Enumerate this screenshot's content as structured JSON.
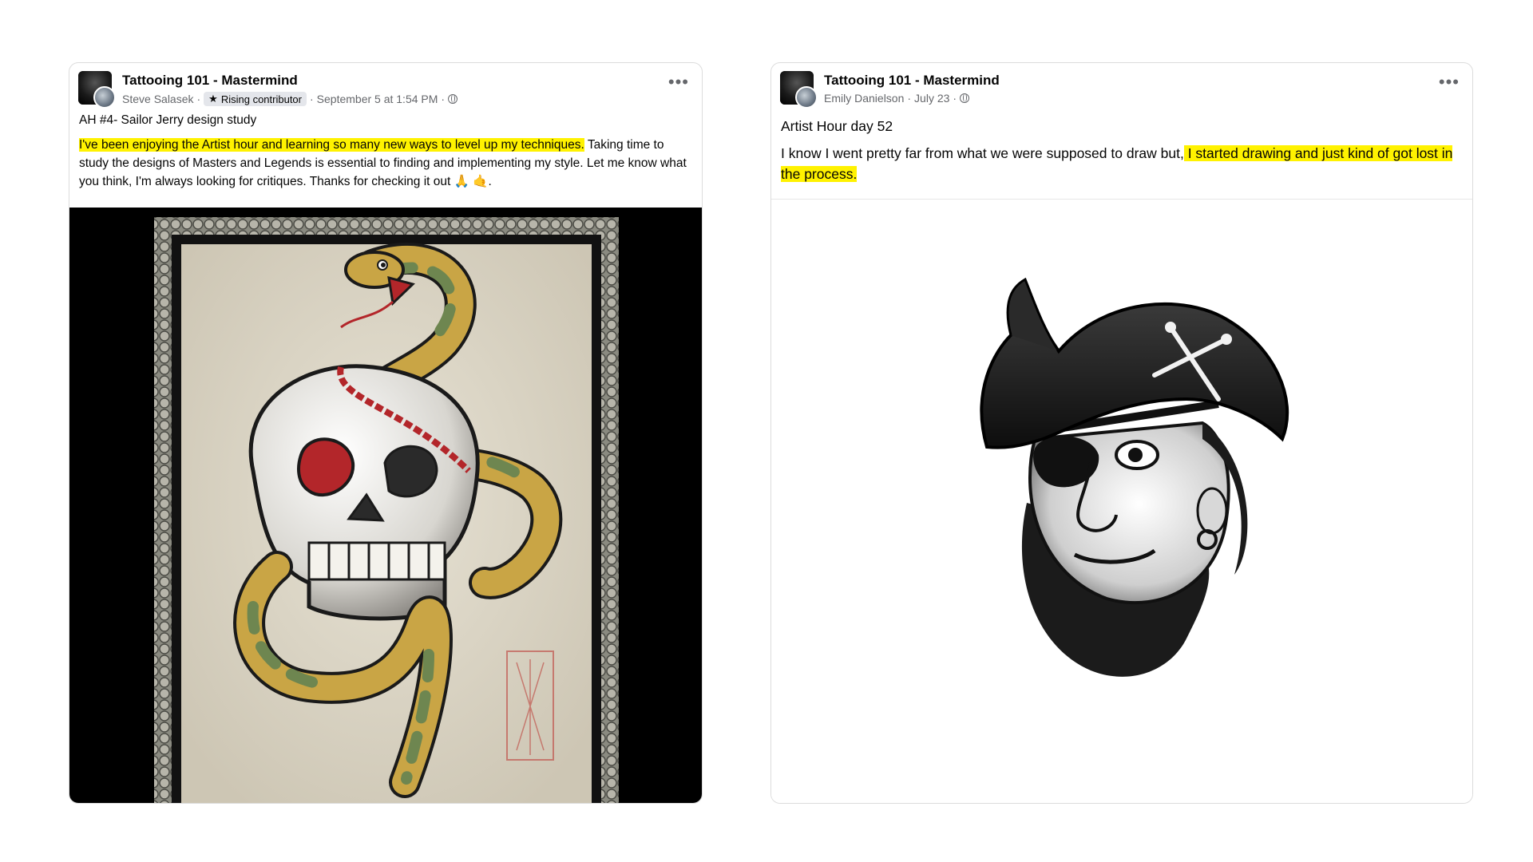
{
  "posts": [
    {
      "group": "Tattooing 101 - Mastermind",
      "author": "Steve Salasek",
      "badge": "Rising contributor",
      "time": "September 5 at 1:54 PM",
      "heading": "AH #4- Sailor Jerry design study",
      "highlight": "I've been enjoying the Artist hour and learning so many new ways to level up my techniques.",
      "rest": " Taking time to study the designs of Masters and Legends is essential to finding and implementing my style. Let me know what you think, I'm always looking for critiques. Thanks for checking it out 🙏 🤙.",
      "image_name": "snake-and-skull-tattoo-flash"
    },
    {
      "group": "Tattooing 101 - Mastermind",
      "author": "Emily Danielson",
      "time": "July 23",
      "heading": "Artist Hour day 52",
      "plain": "I know I went pretty far from what we were supposed to draw but,",
      "highlight": " I started drawing and just kind of got lost in the process.",
      "image_name": "pirate-tattoo-drawing"
    }
  ],
  "icons": {
    "more": "more-options-icon",
    "privacy": "globe-icon",
    "badge": "star-icon"
  },
  "colors": {
    "highlight": "#fff200",
    "meta": "#65676b",
    "badge_bg": "#e4e6eb"
  }
}
